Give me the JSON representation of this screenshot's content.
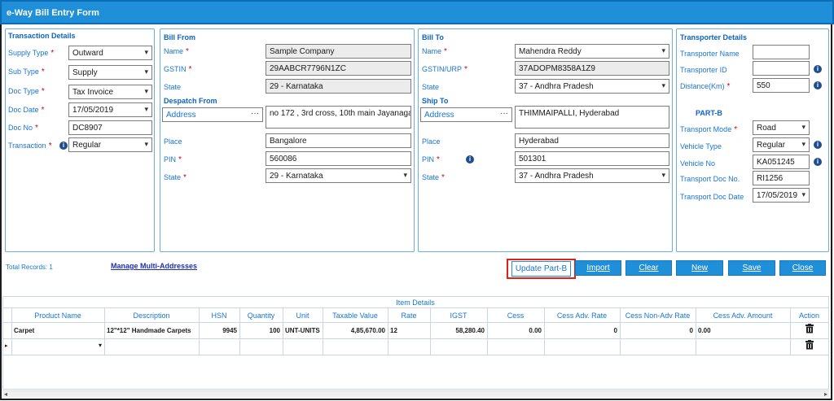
{
  "window": {
    "title": "e-Way Bill Entry Form"
  },
  "transaction": {
    "title": "Transaction Details",
    "supply_type_label": "Supply Type",
    "supply_type": "Outward",
    "sub_type_label": "Sub Type",
    "sub_type": "Supply",
    "doc_type_label": "Doc Type",
    "doc_type": "Tax Invoice",
    "doc_date_label": "Doc Date",
    "doc_date": "17/05/2019",
    "doc_no_label": "Doc No",
    "doc_no": "DC8907",
    "transaction_label": "Transaction",
    "transaction": "Regular"
  },
  "bill_from": {
    "title": "Bill From",
    "name_label": "Name",
    "name": "Sample Company",
    "gstin_label": "GSTIN",
    "gstin": "29AABCR7796N1ZC",
    "state_label": "State",
    "state": "29 - Karnataka",
    "despatch_title": "Despatch From",
    "address_label": "Address",
    "address_btn": "···",
    "address": "no 172 , 3rd cross, 10th main  Jayanagar",
    "place_label": "Place",
    "place": "Bangalore",
    "pin_label": "PIN",
    "pin": "560086",
    "despatch_state_label": "State",
    "despatch_state": "29 - Karnataka"
  },
  "bill_to": {
    "title": "Bill To",
    "name_label": "Name",
    "name": "Mahendra Reddy",
    "gstin_label": "GSTIN/URP",
    "gstin": "37ADOPM8358A1Z9",
    "state_label": "State",
    "state": "37 - Andhra Pradesh",
    "ship_title": "Ship To",
    "address_label": "Address",
    "address_btn": "···",
    "address": "THIMMAIPALLI, Hyderabad",
    "place_label": "Place",
    "place": "Hyderabad",
    "pin_label": "PIN",
    "pin": "501301",
    "ship_state_label": "State",
    "ship_state": "37 - Andhra Pradesh"
  },
  "transporter": {
    "title": "Transporter Details",
    "name_label": "Transporter Name",
    "name": "",
    "id_label": "Transporter ID",
    "id": "",
    "distance_label": "Distance(Km)",
    "distance": "550",
    "partb_title": "PART-B",
    "mode_label": "Transport Mode",
    "mode": "Road",
    "vehicle_type_label": "Vehicle Type",
    "vehicle_type": "Regular",
    "vehicle_no_label": "Vehicle No",
    "vehicle_no": "KA051245",
    "doc_no_label": "Transport Doc No.",
    "doc_no": "RI1256",
    "doc_date_label": "Transport Doc Date",
    "doc_date": "17/05/2019"
  },
  "actions": {
    "total_records": "Total Records: 1",
    "multi_address": "Manage Multi-Addresses",
    "update_partb": "Update Part-B",
    "import": "Import",
    "clear": "Clear",
    "new": "New",
    "save": "Save",
    "close": "Close"
  },
  "grid": {
    "group_title": "Item Details",
    "columns": [
      "Product Name",
      "Description",
      "HSN",
      "Quantity",
      "Unit",
      "Taxable Value",
      "Rate",
      "IGST",
      "Cess",
      "Cess Adv. Rate",
      "Cess Non-Adv Rate",
      "Cess Adv. Amount",
      "Action"
    ],
    "rows": [
      [
        "Carpet",
        "12\"*12\" Handmade Carpets",
        "9945",
        "100",
        "UNT-UNITS",
        "4,85,670.00",
        "12",
        "58,280.40",
        "0.00",
        "0",
        "0",
        "0.00"
      ]
    ]
  },
  "icons": {
    "delete": "trash-icon",
    "info": "info-icon",
    "dropdown": "chevron-down-icon",
    "row_pointer": "row-pointer-icon"
  },
  "colors": {
    "accent": "#1e8fd8",
    "label": "#1875d1",
    "required": "#d0021b",
    "highlight_border": "#e0201b"
  }
}
